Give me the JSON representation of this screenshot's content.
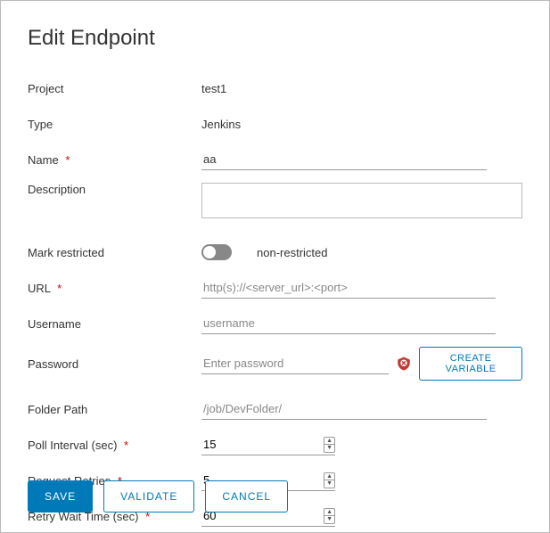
{
  "title": "Edit Endpoint",
  "labels": {
    "project": "Project",
    "type": "Type",
    "name": "Name",
    "description": "Description",
    "mark_restricted": "Mark restricted",
    "url": "URL",
    "username": "Username",
    "password": "Password",
    "folder_path": "Folder Path",
    "poll_interval": "Poll Interval (sec)",
    "request_retries": "Request Retries",
    "retry_wait_time": "Retry Wait Time (sec)"
  },
  "values": {
    "project": "test1",
    "type": "Jenkins",
    "name": "aa",
    "description": "",
    "restricted_state": "non-restricted",
    "url": "",
    "username": "",
    "password": "",
    "folder_path": "",
    "poll_interval": "15",
    "request_retries": "5",
    "retry_wait_time": "60"
  },
  "placeholders": {
    "url": "http(s)://<server_url>:<port>",
    "username": "username",
    "password": "Enter password",
    "folder_path": "/job/DevFolder/"
  },
  "buttons": {
    "create_variable": "CREATE VARIABLE",
    "save": "SAVE",
    "validate": "VALIDATE",
    "cancel": "CANCEL"
  },
  "required_marker": "*"
}
